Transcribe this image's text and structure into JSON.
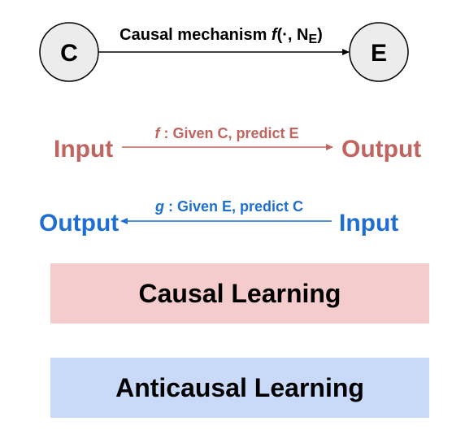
{
  "causal_graph": {
    "cause_node": "C",
    "effect_node": "E",
    "mechanism_label": "Causal mechanism",
    "mechanism_function": "f",
    "mechanism_args_open": "(·, N",
    "mechanism_noise_subscript": "E",
    "mechanism_args_close": ")"
  },
  "causal_task": {
    "left_label": "Input",
    "right_label": "Output",
    "function_symbol": "f",
    "description": " : Given C, predict E",
    "color": "#c0645f"
  },
  "anticausal_task": {
    "left_label": "Output",
    "right_label": "Input",
    "function_symbol": "g",
    "description": " : Given E, predict C",
    "color": "#1f6fd1"
  },
  "boxes": {
    "causal_learning": {
      "label": "Causal Learning",
      "color": "#f4cccc"
    },
    "anticausal_learning": {
      "label": "Anticausal Learning",
      "color": "#c9daf8"
    }
  }
}
